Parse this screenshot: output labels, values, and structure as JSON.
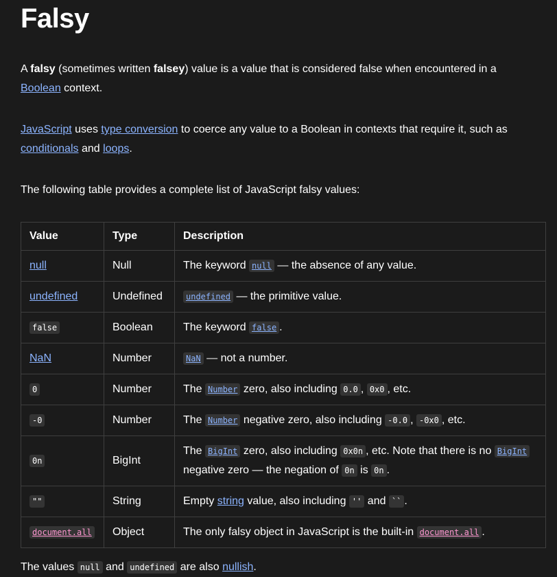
{
  "title": "Falsy",
  "intro": {
    "a": "A ",
    "falsy": "falsy",
    "b": " (sometimes written ",
    "falsey": "falsey",
    "c": ") value is a value that is considered false when encountered in a ",
    "boolean_link": "Boolean",
    "d": " context."
  },
  "conversion": {
    "js_link": "JavaScript",
    "a": " uses ",
    "type_conversion_link": "type conversion",
    "b": " to coerce any value to a Boolean in contexts that require it, such as ",
    "conditionals_link": "conditionals",
    "c": " and ",
    "loops_link": "loops",
    "d": "."
  },
  "table_intro": "The following table provides a complete list of JavaScript falsy values:",
  "table": {
    "headers": [
      "Value",
      "Type",
      "Description"
    ],
    "rows": [
      {
        "value": "null",
        "type": "Null",
        "d1": "The keyword ",
        "code1": "null",
        "d2": " — the absence of any value."
      },
      {
        "value": "undefined",
        "type": "Undefined",
        "code1": "undefined",
        "d2": " — the primitive value."
      },
      {
        "value": "false",
        "type": "Boolean",
        "d1": "The keyword ",
        "code1": "false",
        "d2": "."
      },
      {
        "value": "NaN",
        "type": "Number",
        "code1": "NaN",
        "d2": " — not a number."
      },
      {
        "value": "0",
        "type": "Number",
        "d1": "The ",
        "code1": "Number",
        "d2": " zero, also including ",
        "code2": "0.0",
        "d3": ", ",
        "code3": "0x0",
        "d4": ", etc."
      },
      {
        "value": "-0",
        "type": "Number",
        "d1": "The ",
        "code1": "Number",
        "d2": " negative zero, also including ",
        "code2": "-0.0",
        "d3": ", ",
        "code3": "-0x0",
        "d4": ", etc."
      },
      {
        "value": "0n",
        "type": "BigInt",
        "d1": "The ",
        "code1": "BigInt",
        "d2": " zero, also including ",
        "code2": "0x0n",
        "d3": ", etc. Note that there is no ",
        "code3": "BigInt",
        "d4": " negative zero — the negation of ",
        "code4": "0n",
        "d5": " is ",
        "code5": "0n",
        "d6": "."
      },
      {
        "value": "\"\"",
        "type": "String",
        "d1": "Empty ",
        "link1": "string",
        "d2": " value, also including ",
        "code2": "''",
        "d3": " and ",
        "code3": "``",
        "d4": "."
      },
      {
        "value": "document.all",
        "type": "Object",
        "d1": "The only falsy object in JavaScript is the built-in ",
        "code1": "document.all",
        "d2": "."
      }
    ]
  },
  "footer": {
    "a": "The values ",
    "code1": "null",
    "b": " and ",
    "code2": "undefined",
    "c": " are also ",
    "nullish_link": "nullish",
    "d": "."
  }
}
